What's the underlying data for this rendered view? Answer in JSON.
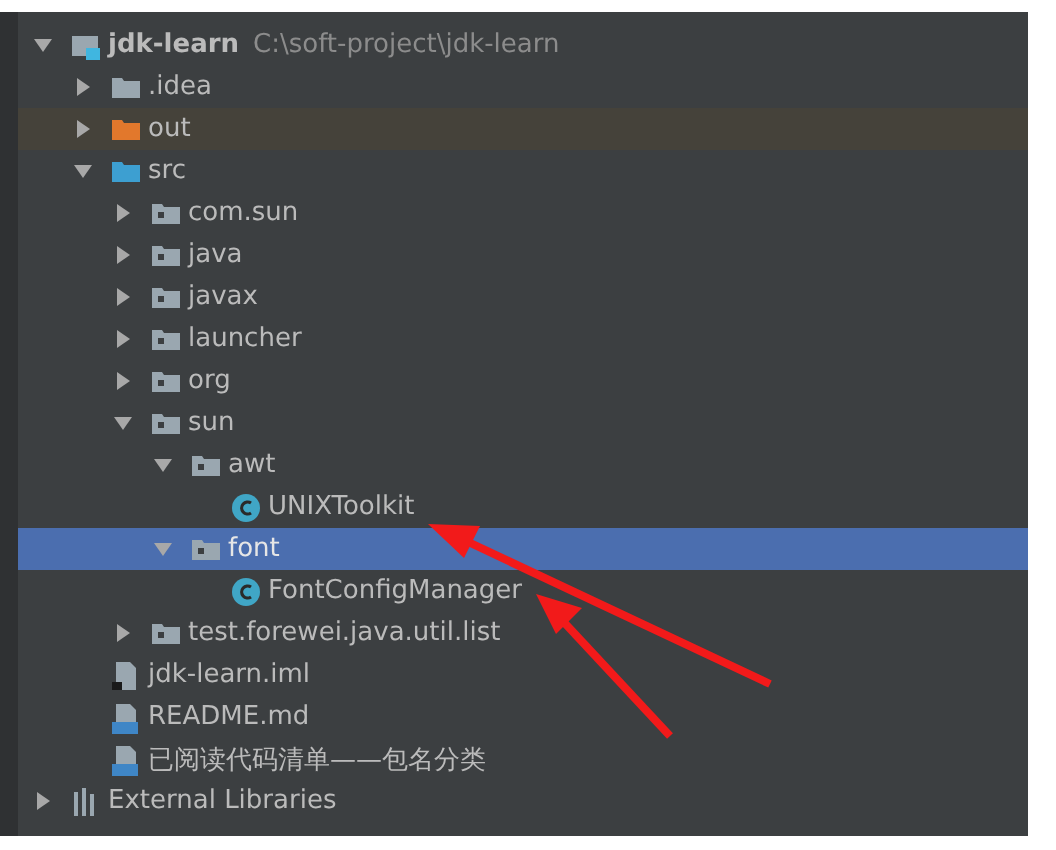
{
  "project_tree": [
    {
      "name": "jdk-learn",
      "path": "C:\\soft-project\\jdk-learn",
      "kind": "module",
      "expanded": true,
      "selected": false,
      "children": [
        {
          "name": ".idea",
          "kind": "folder",
          "expanded": false,
          "selected": false
        },
        {
          "name": "out",
          "kind": "excluded",
          "expanded": false,
          "selected": false
        },
        {
          "name": "src",
          "kind": "source",
          "expanded": true,
          "selected": false,
          "children": [
            {
              "name": "com.sun",
              "kind": "package",
              "expanded": false,
              "selected": false
            },
            {
              "name": "java",
              "kind": "package",
              "expanded": false,
              "selected": false
            },
            {
              "name": "javax",
              "kind": "package",
              "expanded": false,
              "selected": false
            },
            {
              "name": "launcher",
              "kind": "package",
              "expanded": false,
              "selected": false
            },
            {
              "name": "org",
              "kind": "package",
              "expanded": false,
              "selected": false
            },
            {
              "name": "sun",
              "kind": "package",
              "expanded": true,
              "selected": false,
              "children": [
                {
                  "name": "awt",
                  "kind": "package",
                  "expanded": true,
                  "selected": false,
                  "children": [
                    {
                      "name": "UNIXToolkit",
                      "kind": "class",
                      "selected": false
                    }
                  ]
                },
                {
                  "name": "font",
                  "kind": "package",
                  "expanded": true,
                  "selected": true,
                  "children": [
                    {
                      "name": "FontConfigManager",
                      "kind": "class",
                      "selected": false
                    }
                  ]
                }
              ]
            },
            {
              "name": "test.forewei.java.util.list",
              "kind": "package",
              "expanded": false,
              "selected": false
            }
          ]
        },
        {
          "name": "jdk-learn.iml",
          "kind": "iml",
          "selected": false
        },
        {
          "name": "README.md",
          "kind": "md",
          "selected": false
        },
        {
          "name": "已阅读代码清单——包名分类",
          "kind": "md",
          "selected": false
        }
      ]
    },
    {
      "name": "External Libraries",
      "kind": "libraries",
      "expanded": false,
      "selected": false
    }
  ]
}
